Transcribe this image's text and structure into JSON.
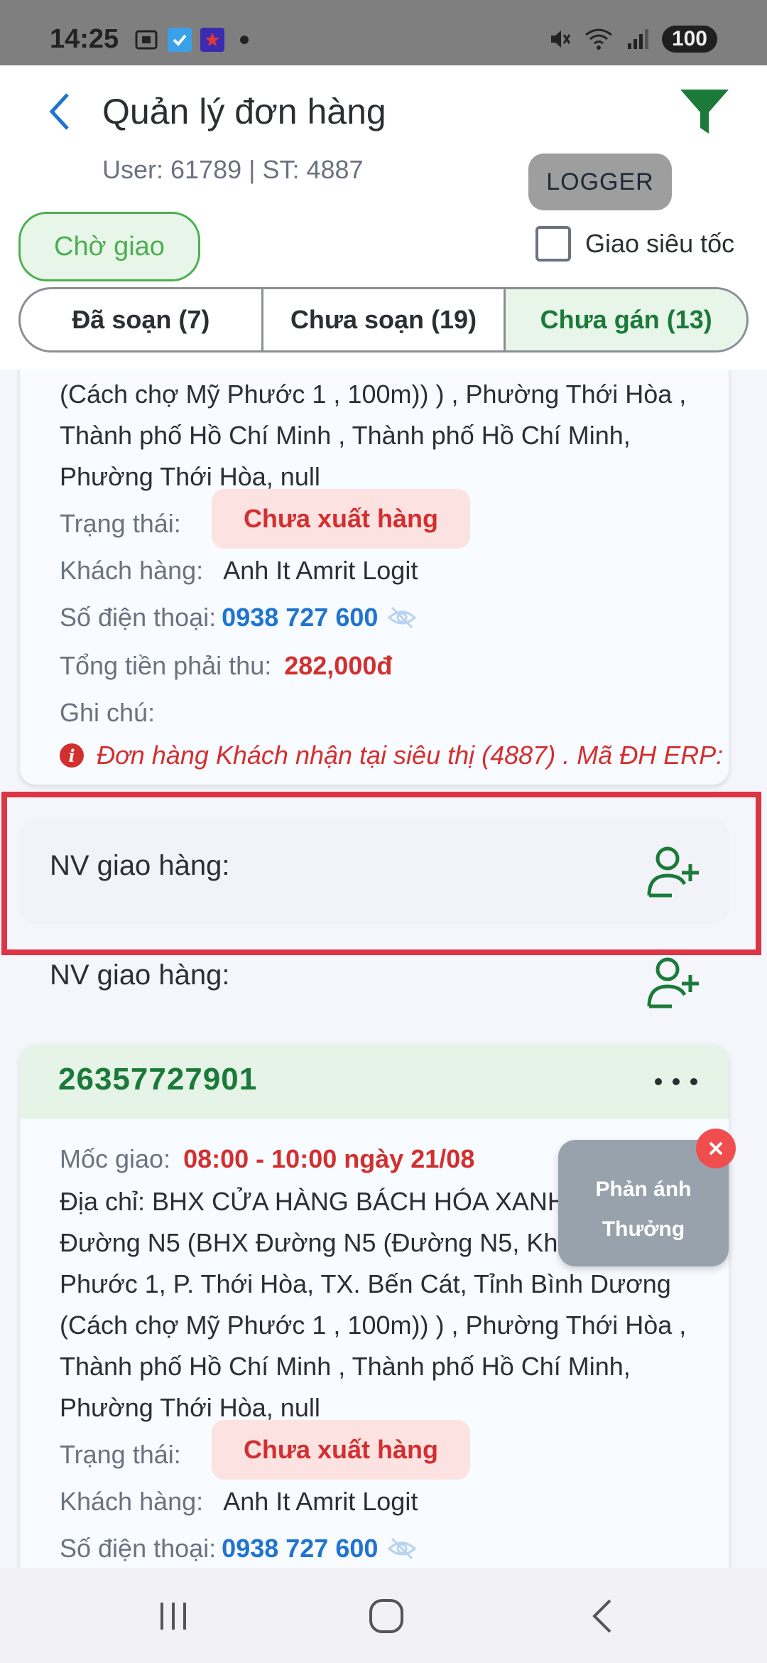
{
  "status_bar": {
    "time": "14:25",
    "battery": "100",
    "icons": [
      "screenshot-icon",
      "check-app-icon",
      "star-app-icon",
      "mute-icon",
      "wifi-icon",
      "signal-icon"
    ]
  },
  "header": {
    "title": "Quản lý đơn hàng",
    "subtitle": "User: 61789 | ST: 4887",
    "logger_label": "LOGGER",
    "pending_chip": "Chờ giao",
    "express_label": "Giao siêu tốc"
  },
  "tabs": [
    {
      "label": "Đã soạn (7)",
      "active": false
    },
    {
      "label": "Chưa soạn (19)",
      "active": false
    },
    {
      "label": "Chưa gán (13)",
      "active": true
    }
  ],
  "orders": [
    {
      "address_lines": [
        "(Cách chợ Mỹ Phước 1 , 100m)) ) , Phường Thới Hòa ,",
        "Thành phố Hồ Chí Minh , Thành phố Hồ Chí Minh,",
        "Phường Thới Hòa, null"
      ],
      "status_label": "Trạng thái:",
      "status_value": "Chưa xuất hàng",
      "customer_label": "Khách hàng:",
      "customer_value": "Anh It Amrit Logit",
      "phone_label": "Số điện thoại:",
      "phone_value": "0938 727 600",
      "total_label": "Tổng tiền phải thu:",
      "total_value": "282,000đ",
      "note_label": "Ghi chú:",
      "note_value": "Đơn hàng Khách nhận tại siêu thị (4887) . Mã ĐH ERP:"
    },
    {
      "id": "26357727901",
      "deadline_label": "Mốc giao:",
      "deadline_value": "08:00 - 10:00 ngày 21/08",
      "address_lines": [
        "Địa chỉ: BHX CỬA HÀNG BÁCH HÓA XANH",
        "Đường N5  (BHX Đường N5 (Đường N5, Kh",
        "Phước 1, P. Thới Hòa, TX. Bến Cát, Tỉnh Bình Dương",
        "(Cách chợ Mỹ Phước 1 , 100m)) ) , Phường Thới Hòa ,",
        "Thành phố Hồ Chí Minh , Thành phố Hồ Chí Minh,",
        "Phường Thới Hòa, null"
      ],
      "status_label": "Trạng thái:",
      "status_value": "Chưa xuất hàng",
      "customer_label": "Khách hàng:",
      "customer_value": "Anh It Amrit Logit",
      "phone_label": "Số điện thoại:",
      "phone_value": "0938 727 600"
    }
  ],
  "assign_label": "NV giao hàng:",
  "feedback_widget": {
    "line1": "Phản ánh",
    "line2": "Thưởng"
  },
  "colors": {
    "accent_green": "#1b7a3a",
    "chip_green": "#4caf50",
    "alert_red": "#d32f2f",
    "phone_blue": "#1e74d0",
    "highlight_red": "#dc3545"
  }
}
